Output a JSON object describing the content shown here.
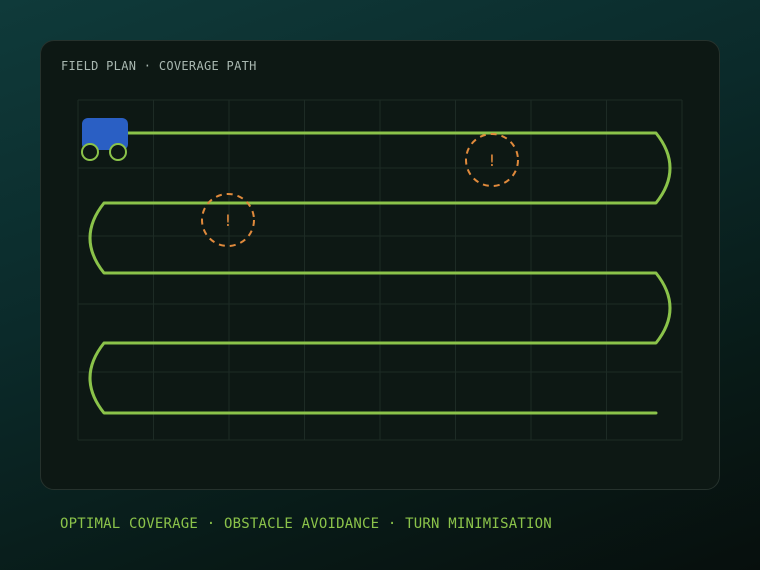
{
  "panel": {
    "title": "FIELD PLAN · COVERAGE PATH"
  },
  "field": {
    "grid_columns": 8,
    "grid_rows": 5,
    "path_rows": 5,
    "path_color": "#8bc34a",
    "grid_color": "#1d2b25",
    "obstacles": [
      {
        "name": "obstacle-1",
        "label": "!"
      },
      {
        "name": "obstacle-2",
        "label": "!"
      }
    ],
    "obstacle_color": "#e08a3c",
    "robot": {
      "body_color": "#2a5fc4",
      "wheel_color": "#8bc34a"
    }
  },
  "footer": {
    "caption": "OPTIMAL COVERAGE · OBSTACLE AVOIDANCE · TURN MINIMISATION"
  },
  "colors": {
    "panel_bg": "#0d1814",
    "accent": "#8bc34a",
    "warning": "#e08a3c",
    "robot": "#2a5fc4"
  }
}
